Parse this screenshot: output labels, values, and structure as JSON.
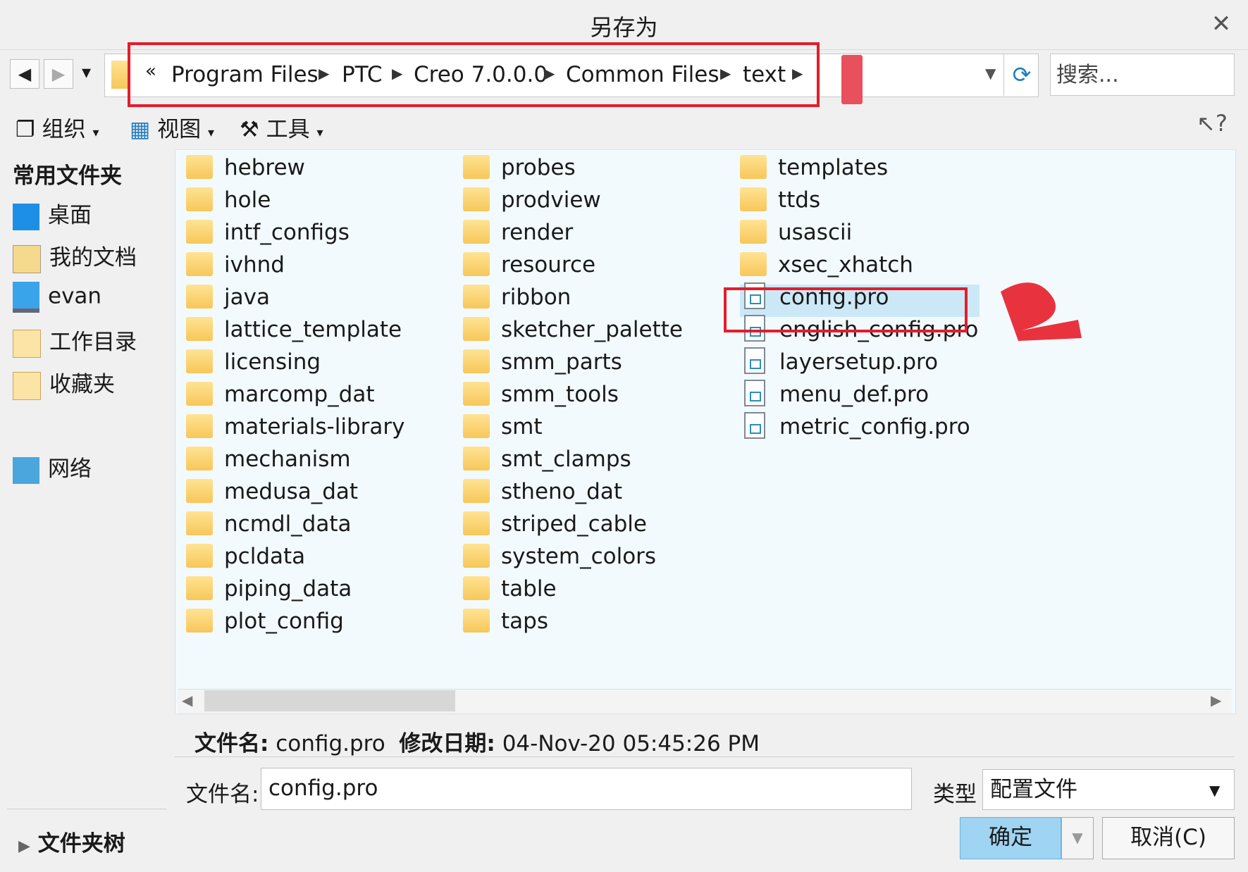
{
  "window": {
    "title": "另存为",
    "close_glyph": "✕"
  },
  "nav": {
    "back_glyph": "◀",
    "forward_glyph": "▶",
    "dropdown_glyph": "▾",
    "overflow_glyph": "«",
    "breadcrumb": [
      "Program Files",
      "PTC",
      "Creo 7.0.0.0",
      "Common Files",
      "text"
    ],
    "refresh_glyph": "⟳",
    "search_placeholder": "搜索..."
  },
  "toolbar": {
    "organize": "组织",
    "view": "视图",
    "tools": "工具",
    "help_glyph": "?"
  },
  "sidebar": {
    "header": "常用文件夹",
    "items": [
      "桌面",
      "我的文档",
      "evan",
      "工作目录",
      "收藏夹"
    ],
    "network": "网络",
    "folder_tree": "文件夹树"
  },
  "files": {
    "col1": [
      "hebrew",
      "hole",
      "intf_configs",
      "ivhnd",
      "java",
      "lattice_template",
      "licensing",
      "marcomp_dat",
      "materials-library",
      "mechanism",
      "medusa_dat",
      "ncmdl_data",
      "pcldata",
      "piping_data",
      "plot_config"
    ],
    "col2": [
      "probes",
      "prodview",
      "render",
      "resource",
      "ribbon",
      "sketcher_palette",
      "smm_parts",
      "smm_tools",
      "smt",
      "smt_clamps",
      "stheno_dat",
      "striped_cable",
      "system_colors",
      "table",
      "taps"
    ],
    "col3_folders": [
      "templates",
      "ttds",
      "usascii",
      "xsec_xhatch"
    ],
    "col3_files": [
      "config.pro",
      "english_config.pro",
      "layersetup.pro",
      "menu_def.pro",
      "metric_config.pro"
    ],
    "selected": "config.pro"
  },
  "info": {
    "name_label": "文件名:",
    "name_value": "config.pro",
    "date_label": "修改日期:",
    "date_value": "04-Nov-20 05:45:26 PM"
  },
  "footer": {
    "filename_label": "文件名:",
    "filename_value": "config.pro",
    "type_label": "类型",
    "type_value": "配置文件",
    "ok": "确定",
    "cancel": "取消(C)"
  },
  "colors": {
    "annotation": "#e31d2b",
    "selection": "#cce8f6",
    "ok_button": "#9fd4f2"
  }
}
